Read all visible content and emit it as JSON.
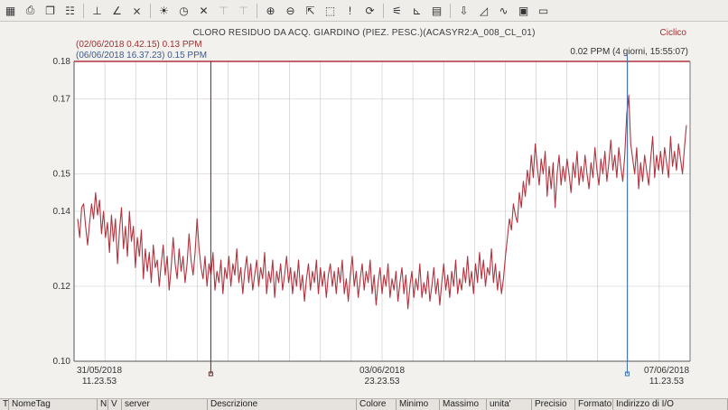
{
  "toolbar": {
    "icons": [
      "grid-icon",
      "print-icon",
      "copy-icon",
      "properties-icon",
      "axis-x-icon",
      "axis-y-icon",
      "axis-off-icon",
      "light-bulb-icon",
      "clock-icon",
      "close-icon",
      "disabled-a-icon",
      "disabled-b-icon",
      "zoom-in-icon",
      "zoom-out-icon",
      "pan-icon",
      "zoom-box-icon",
      "alert-icon",
      "refresh-icon",
      "chart-settings-icon",
      "chart-y-icon",
      "chart-table-icon",
      "chart-down-icon",
      "chart-area-icon",
      "chart-wave-icon",
      "chart-export-icon",
      "chart-frame-icon"
    ]
  },
  "header": {
    "title": "CLORO RESIDUO DA ACQ. GIARDINO (PIEZ. PESC.)(ACASYR2:A_008_CL_01)",
    "mode": "Ciclico",
    "cursor_a": "(02/06/2018 0.42.15)  0.13 PPM",
    "cursor_b": "(06/06/2018 16.37.23)  0.15 PPM",
    "delta": "0.02 PPM (4 giorni, 15:55:07)"
  },
  "chart_data": {
    "type": "line",
    "series": [
      {
        "values": [
          0.138,
          0.133,
          0.141,
          0.142,
          0.136,
          0.131,
          0.137,
          0.142,
          0.138,
          0.145,
          0.139,
          0.143,
          0.134,
          0.14,
          0.133,
          0.137,
          0.129,
          0.139,
          0.132,
          0.138,
          0.126,
          0.135,
          0.141,
          0.13,
          0.136,
          0.128,
          0.14,
          0.132,
          0.136,
          0.125,
          0.133,
          0.128,
          0.135,
          0.122,
          0.13,
          0.124,
          0.129,
          0.121,
          0.131,
          0.125,
          0.127,
          0.12,
          0.126,
          0.131,
          0.123,
          0.128,
          0.119,
          0.125,
          0.133,
          0.126,
          0.122,
          0.13,
          0.124,
          0.128,
          0.121,
          0.126,
          0.134,
          0.127,
          0.123,
          0.129,
          0.138,
          0.13,
          0.125,
          0.122,
          0.128,
          0.12,
          0.126,
          0.123,
          0.129,
          0.119,
          0.124,
          0.121,
          0.127,
          0.118,
          0.125,
          0.122,
          0.128,
          0.12,
          0.126,
          0.123,
          0.13,
          0.121,
          0.125,
          0.118,
          0.124,
          0.128,
          0.121,
          0.126,
          0.119,
          0.123,
          0.127,
          0.12,
          0.125,
          0.122,
          0.129,
          0.118,
          0.124,
          0.121,
          0.127,
          0.117,
          0.124,
          0.121,
          0.126,
          0.119,
          0.123,
          0.128,
          0.121,
          0.125,
          0.118,
          0.124,
          0.12,
          0.127,
          0.119,
          0.123,
          0.116,
          0.122,
          0.126,
          0.119,
          0.124,
          0.121,
          0.127,
          0.118,
          0.125,
          0.12,
          0.124,
          0.117,
          0.123,
          0.126,
          0.12,
          0.124,
          0.118,
          0.125,
          0.121,
          0.127,
          0.118,
          0.122,
          0.116,
          0.123,
          0.128,
          0.12,
          0.124,
          0.117,
          0.122,
          0.126,
          0.119,
          0.124,
          0.121,
          0.127,
          0.118,
          0.123,
          0.115,
          0.121,
          0.125,
          0.118,
          0.123,
          0.12,
          0.126,
          0.117,
          0.122,
          0.119,
          0.124,
          0.116,
          0.121,
          0.125,
          0.118,
          0.123,
          0.114,
          0.12,
          0.124,
          0.117,
          0.122,
          0.119,
          0.126,
          0.117,
          0.121,
          0.118,
          0.124,
          0.116,
          0.12,
          0.125,
          0.118,
          0.122,
          0.115,
          0.121,
          0.126,
          0.119,
          0.123,
          0.117,
          0.124,
          0.12,
          0.127,
          0.118,
          0.122,
          0.119,
          0.125,
          0.121,
          0.128,
          0.12,
          0.124,
          0.118,
          0.126,
          0.121,
          0.129,
          0.122,
          0.127,
          0.12,
          0.125,
          0.123,
          0.13,
          0.121,
          0.126,
          0.119,
          0.124,
          0.118,
          0.122,
          0.128,
          0.133,
          0.138,
          0.135,
          0.142,
          0.139,
          0.137,
          0.145,
          0.141,
          0.148,
          0.144,
          0.151,
          0.147,
          0.155,
          0.149,
          0.158,
          0.152,
          0.147,
          0.154,
          0.15,
          0.156,
          0.144,
          0.152,
          0.146,
          0.153,
          0.141,
          0.15,
          0.155,
          0.147,
          0.152,
          0.148,
          0.154,
          0.15,
          0.145,
          0.153,
          0.149,
          0.156,
          0.147,
          0.152,
          0.148,
          0.155,
          0.15,
          0.146,
          0.153,
          0.149,
          0.157,
          0.151,
          0.147,
          0.154,
          0.15,
          0.156,
          0.148,
          0.153,
          0.159,
          0.151,
          0.155,
          0.149,
          0.157,
          0.152,
          0.148,
          0.155,
          0.166,
          0.171,
          0.158,
          0.154,
          0.15,
          0.157,
          0.146,
          0.153,
          0.148,
          0.155,
          0.151,
          0.147,
          0.154,
          0.16,
          0.149,
          0.155,
          0.151,
          0.156,
          0.15,
          0.157,
          0.153,
          0.149,
          0.16,
          0.152,
          0.156,
          0.151,
          0.158,
          0.154,
          0.15,
          0.157,
          0.163
        ]
      }
    ],
    "ylim": [
      0.1,
      0.18
    ],
    "yticks": [
      "0.18",
      "0.17",
      "0.15",
      "0.14",
      "0.12",
      "0.10"
    ],
    "xticks": [
      {
        "date": "31/05/2018",
        "time": "11.23.53"
      },
      {
        "date": "03/06/2018",
        "time": "23.23.53"
      },
      {
        "date": "07/06/2018",
        "time": "11.23.53"
      }
    ],
    "x_range": [
      "31/05/2018 11.23.53",
      "07/06/2018 11.23.53"
    ],
    "cursor_a_position_fraction": 0.222,
    "cursor_b_position_fraction": 0.898,
    "colors": {
      "line": "#b0343f",
      "frame_top": "#b0343f",
      "cursor_a": "#7a1f1f",
      "cursor_b": "#3d6fb0",
      "grid": "#c9c6c1"
    },
    "grid": true
  },
  "table_header": {
    "columns": [
      "T",
      "NomeTag",
      "N",
      "V",
      "server",
      "Descrizione",
      "Colore",
      "Minimo",
      "Massimo",
      "unita'",
      "Precisio",
      "Formato",
      "Indirizzo di I/O"
    ]
  }
}
